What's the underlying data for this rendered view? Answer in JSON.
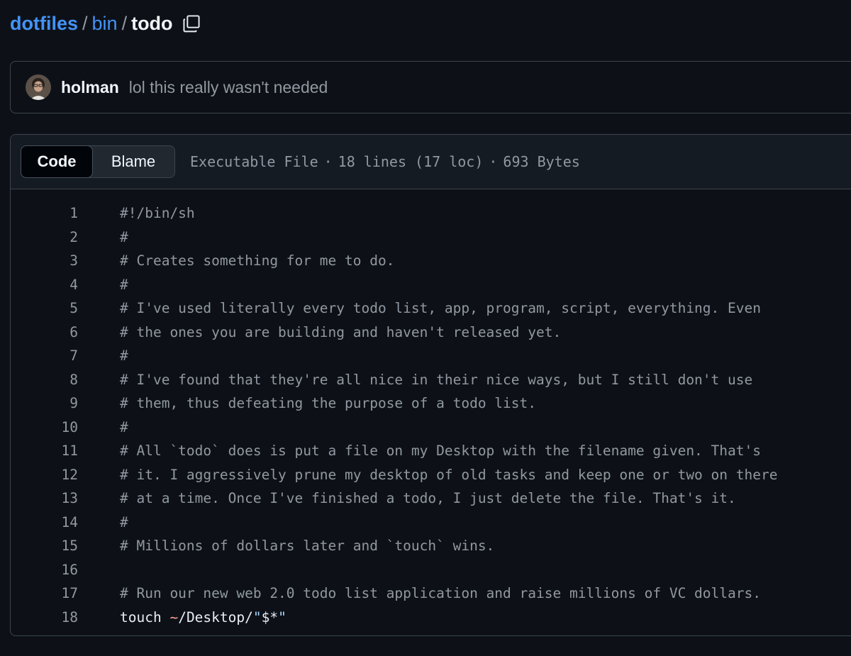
{
  "breadcrumb": {
    "repo": "dotfiles",
    "sep1": "/",
    "folder": "bin",
    "sep2": "/",
    "file": "todo",
    "copy_icon": "copy-icon"
  },
  "commit": {
    "author": "holman",
    "message": "lol this really wasn't needed",
    "avatar_icon": "avatar"
  },
  "file_header": {
    "tabs": [
      {
        "label": "Code",
        "active": true
      },
      {
        "label": "Blame",
        "active": false
      }
    ],
    "file_type": "Executable File",
    "lines_info": "18 lines (17 loc)",
    "size": "693 Bytes",
    "separator": "·"
  },
  "code": {
    "lines": [
      {
        "num": "1",
        "text": "#!/bin/sh",
        "kind": "plain"
      },
      {
        "num": "2",
        "text": "#",
        "kind": "plain"
      },
      {
        "num": "3",
        "text": "# Creates something for me to do.",
        "kind": "plain"
      },
      {
        "num": "4",
        "text": "#",
        "kind": "plain"
      },
      {
        "num": "5",
        "text": "# I've used literally every todo list, app, program, script, everything. Even",
        "kind": "plain"
      },
      {
        "num": "6",
        "text": "# the ones you are building and haven't released yet.",
        "kind": "plain"
      },
      {
        "num": "7",
        "text": "#",
        "kind": "plain"
      },
      {
        "num": "8",
        "text": "# I've found that they're all nice in their nice ways, but I still don't use",
        "kind": "plain"
      },
      {
        "num": "9",
        "text": "# them, thus defeating the purpose of a todo list.",
        "kind": "plain"
      },
      {
        "num": "10",
        "text": "#",
        "kind": "plain"
      },
      {
        "num": "11",
        "text": "# All `todo` does is put a file on my Desktop with the filename given. That's",
        "kind": "plain"
      },
      {
        "num": "12",
        "text": "# it. I aggressively prune my desktop of old tasks and keep one or two on there",
        "kind": "plain"
      },
      {
        "num": "13",
        "text": "# at a time. Once I've finished a todo, I just delete the file. That's it.",
        "kind": "plain"
      },
      {
        "num": "14",
        "text": "#",
        "kind": "plain"
      },
      {
        "num": "15",
        "text": "# Millions of dollars later and `touch` wins.",
        "kind": "plain"
      },
      {
        "num": "16",
        "text": "",
        "kind": "plain"
      },
      {
        "num": "17",
        "text": "# Run our new web 2.0 todo list application and raise millions of VC dollars.",
        "kind": "plain"
      },
      {
        "num": "18",
        "text": "touch ~/Desktop/\"$*\"",
        "kind": "command",
        "parts": [
          {
            "text": "touch ",
            "cls": ""
          },
          {
            "text": "~",
            "cls": "tilde"
          },
          {
            "text": "/Desktop/",
            "cls": ""
          },
          {
            "text": "\"",
            "cls": "str"
          },
          {
            "text": "$*",
            "cls": ""
          },
          {
            "text": "\"",
            "cls": "str"
          }
        ]
      }
    ]
  },
  "colors": {
    "background": "#0d1117",
    "link": "#4493f8",
    "muted": "#9198a1",
    "tilde": "#ffa198",
    "string": "#a5d6ff"
  }
}
